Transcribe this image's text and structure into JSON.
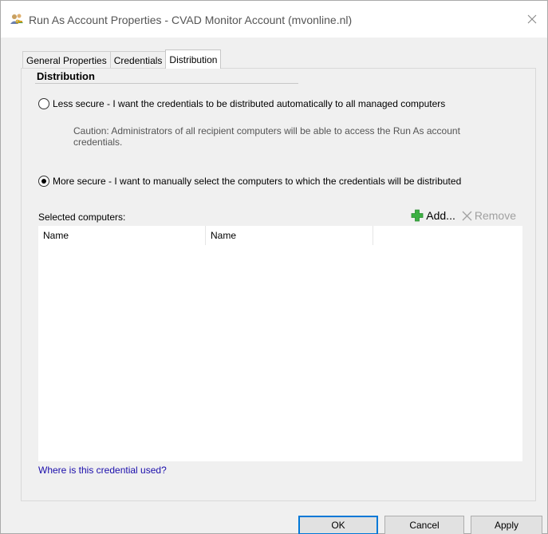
{
  "window": {
    "title": "Run As Account Properties - CVAD Monitor Account (mvonline.nl)"
  },
  "tabs": [
    {
      "label": "General Properties",
      "active": false
    },
    {
      "label": "Credentials",
      "active": false
    },
    {
      "label": "Distribution",
      "active": true
    }
  ],
  "distribution": {
    "group_title": "Distribution",
    "option_less_secure": {
      "label": "Less secure - I want the credentials to be distributed automatically to all managed computers",
      "checked": false
    },
    "caution": "Caution: Administrators of all recipient computers will be able to access the Run As account credentials.",
    "option_more_secure": {
      "label": "More secure - I want to manually select the computers to which the credentials will be distributed",
      "checked": true
    },
    "selected_computers_label": "Selected computers:",
    "add_label": "Add...",
    "remove_label": "Remove",
    "columns": [
      "Name",
      "Name"
    ],
    "rows": [],
    "help_link": "Where is this credential used?"
  },
  "buttons": {
    "ok": "OK",
    "cancel": "Cancel",
    "apply": "Apply"
  },
  "colors": {
    "accent": "#0078d7",
    "link": "#1a0dab",
    "add_icon": "#3cb043"
  },
  "icons": {
    "app": "users-key-icon",
    "close": "close-icon",
    "add": "plus-icon",
    "remove": "x-icon"
  }
}
